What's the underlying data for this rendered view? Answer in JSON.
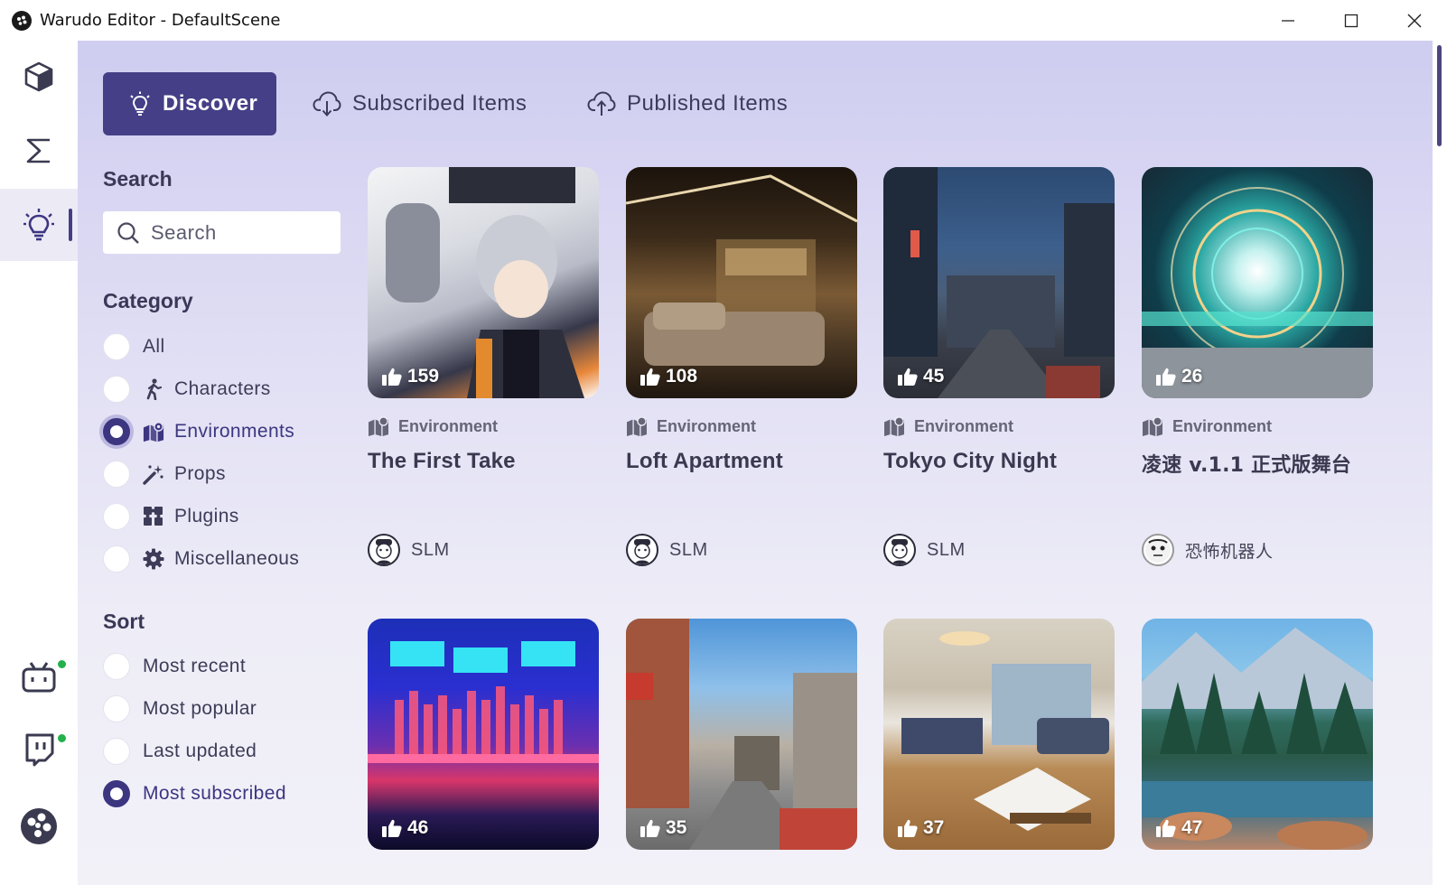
{
  "window": {
    "title": "Warudo Editor - DefaultScene"
  },
  "rail": {
    "items": [
      "cube-icon",
      "sigma-icon",
      "lightbulb-icon"
    ],
    "bottom_items": [
      "bilibili-icon",
      "twitch-icon",
      "warudo-logo-icon"
    ]
  },
  "tabs": [
    {
      "label": "Discover",
      "icon": "lightbulb-icon",
      "active": true
    },
    {
      "label": "Subscribed Items",
      "icon": "cloud-download-icon",
      "active": false
    },
    {
      "label": "Published Items",
      "icon": "cloud-upload-icon",
      "active": false
    }
  ],
  "sidebar": {
    "search_title": "Search",
    "search_placeholder": "Search",
    "category_title": "Category",
    "categories": [
      {
        "label": "All",
        "icon": "",
        "checked": false
      },
      {
        "label": "Characters",
        "icon": "person-walking-icon",
        "checked": false
      },
      {
        "label": "Environments",
        "icon": "map-icon",
        "checked": true
      },
      {
        "label": "Props",
        "icon": "wand-sparkles-icon",
        "checked": false
      },
      {
        "label": "Plugins",
        "icon": "puzzle-icon",
        "checked": false
      },
      {
        "label": "Miscellaneous",
        "icon": "gear-icon",
        "checked": false
      }
    ],
    "sort_title": "Sort",
    "sorts": [
      {
        "label": "Most recent",
        "checked": false
      },
      {
        "label": "Most popular",
        "checked": false
      },
      {
        "label": "Last updated",
        "checked": false
      },
      {
        "label": "Most subscribed",
        "checked": true
      }
    ]
  },
  "cards": [
    {
      "likes": "159",
      "category": "Environment",
      "title": "The First Take",
      "author": "SLM"
    },
    {
      "likes": "108",
      "category": "Environment",
      "title": "Loft Apartment",
      "author": "SLM"
    },
    {
      "likes": "45",
      "category": "Environment",
      "title": "Tokyo City Night",
      "author": "SLM"
    },
    {
      "likes": "26",
      "category": "Environment",
      "title": "凌速 v.1.1 正式版舞台",
      "author": "恐怖机器人"
    },
    {
      "likes": "46"
    },
    {
      "likes": "35"
    },
    {
      "likes": "37"
    },
    {
      "likes": "47"
    }
  ],
  "colors": {
    "accent": "#453f87",
    "online": "#22b14c"
  }
}
